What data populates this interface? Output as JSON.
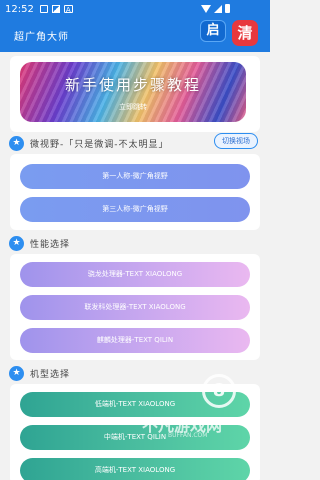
{
  "statusbar": {
    "time": "12:52"
  },
  "appbar": {
    "title": "超广角大师",
    "btn_qi": "启",
    "btn_qing": "清"
  },
  "banner": {
    "title": "新手使用步骤教程",
    "subtitle": "立即跳转"
  },
  "sections": {
    "view": {
      "title": "微视野-「只是微调-不太明显」",
      "switch_label": "切换视场",
      "items": [
        "第一人称-微广角视野",
        "第三人称-微广角视野"
      ]
    },
    "perf": {
      "title": "性能选择",
      "items": [
        "骁龙处理器-TEXT XIAOLONG",
        "联发科处理器-TEXT XIAOLONG",
        "麒麟处理器-TEXT QILIN"
      ]
    },
    "model": {
      "title": "机型选择",
      "items": [
        "低端机-TEXT XIAOLONG",
        "中端机-TEXT QILIN",
        "高端机-TEXT XIAOLONG"
      ]
    }
  },
  "watermark": {
    "text": "不凡游戏网",
    "url": "BUFFAN.COM",
    "mark": "8"
  },
  "colors": {
    "primary": "#1f7be0",
    "accent_red": "#e8383d"
  }
}
